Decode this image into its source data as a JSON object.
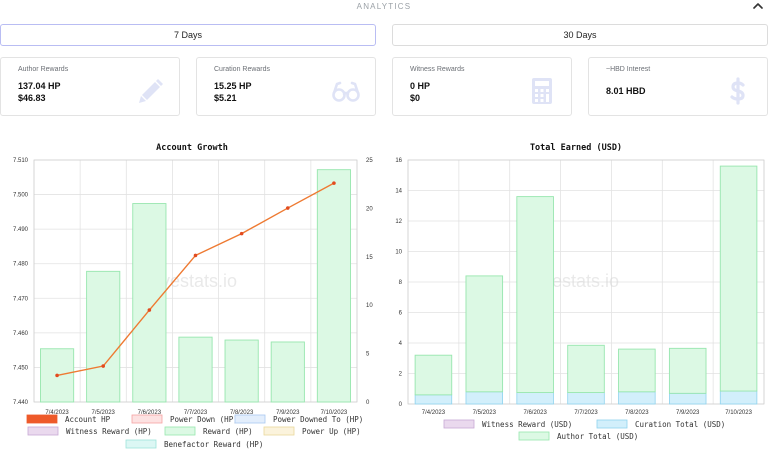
{
  "header": {
    "title": "ANALYTICS"
  },
  "range": {
    "btn7": "7 Days",
    "btn30": "30 Days"
  },
  "cards": {
    "author": {
      "label": "Author Rewards",
      "hp": "137.04 HP",
      "usd": "$46.83"
    },
    "curation": {
      "label": "Curation Rewards",
      "hp": "15.25 HP",
      "usd": "$5.21"
    },
    "witness": {
      "label": "Witness Rewards",
      "hp": "0 HP",
      "usd": "$0"
    },
    "hbd": {
      "label": "~HBD Interest",
      "value": "8.01 HBD"
    }
  },
  "icons": {
    "author": "pencil-icon",
    "curation": "glasses-icon",
    "witness": "calculator-icon",
    "hbd": "dollar-icon",
    "collapse": "chevron-up-icon"
  },
  "colors": {
    "bar_fill": "#dcf9e4",
    "bar_stroke": "#97e6ae",
    "line": "#ee7a32",
    "accent": "#b9bdf3",
    "icon": "#dfe3f6",
    "curation_fill": "#d2effb",
    "curation_stroke": "#8fd3ee"
  },
  "chart_data": [
    {
      "type": "bar",
      "title": "Account Growth",
      "watermark": "hivestats.io",
      "categories": [
        "7/4/2023",
        "7/5/2023",
        "7/6/2023",
        "7/7/2023",
        "7/8/2023",
        "7/9/2023",
        "7/10/2023"
      ],
      "y_left": {
        "ylim": [
          7.44,
          7.51
        ],
        "ticks": [
          "7.510",
          "7.500",
          "7.490",
          "7.480",
          "7.470",
          "7.460",
          "7.450",
          "7.440"
        ]
      },
      "y_right": {
        "ylim": [
          0,
          25
        ],
        "ticks": [
          "25",
          "20",
          "15",
          "10",
          "5",
          "0"
        ]
      },
      "series": [
        {
          "name": "Account HP",
          "type": "line",
          "axis": "left",
          "values": [
            7.4477,
            7.4504,
            7.4666,
            7.4824,
            7.4887,
            7.4961,
            7.5033
          ]
        },
        {
          "name": "Reward (HP)",
          "type": "bar",
          "axis": "right",
          "values": [
            5.5,
            13.5,
            20.5,
            6.7,
            6.4,
            6.2,
            24.0
          ]
        }
      ],
      "legend": [
        {
          "name": "Account HP",
          "fill": "#ee5a2a",
          "stroke": "#ee5a2a"
        },
        {
          "name": "Power Down (HP)",
          "fill": "#fde2e2",
          "stroke": "#f5a3a3"
        },
        {
          "name": "Power Downed To (HP)",
          "fill": "#e3eefc",
          "stroke": "#a9c8f0"
        },
        {
          "name": "Witness Reward (HP)",
          "fill": "#ead9ee",
          "stroke": "#c8a8d4"
        },
        {
          "name": "Reward (HP)",
          "fill": "#dcf9e4",
          "stroke": "#97e6ae"
        },
        {
          "name": "Power Up (HP)",
          "fill": "#fbf3dc",
          "stroke": "#ead89c"
        },
        {
          "name": "Benefactor Reward (HP)",
          "fill": "#dcf7f4",
          "stroke": "#9ee3da"
        }
      ],
      "grid": true
    },
    {
      "type": "bar",
      "title": "Total Earned (USD)",
      "watermark": "hivestats.io",
      "categories": [
        "7/4/2023",
        "7/5/2023",
        "7/6/2023",
        "7/7/2023",
        "7/8/2023",
        "7/9/2023",
        "7/10/2023"
      ],
      "ylim": [
        0,
        16
      ],
      "y_ticks": [
        "16",
        "14",
        "12",
        "10",
        "8",
        "6",
        "4",
        "2",
        "0"
      ],
      "series": [
        {
          "name": "Witness Reward (USD)",
          "values": [
            0,
            0,
            0,
            0,
            0,
            0,
            0
          ]
        },
        {
          "name": "Curation Total (USD)",
          "values": [
            0.6,
            0.8,
            0.75,
            0.75,
            0.8,
            0.7,
            0.85
          ]
        },
        {
          "name": "Author Total (USD)",
          "values": [
            2.6,
            7.6,
            12.85,
            3.1,
            2.8,
            2.95,
            14.75
          ]
        }
      ],
      "legend": [
        {
          "name": "Witness Reward (USD)",
          "fill": "#ead9ee",
          "stroke": "#c8a8d4"
        },
        {
          "name": "Curation Total (USD)",
          "fill": "#d2effb",
          "stroke": "#8fd3ee"
        },
        {
          "name": "Author Total (USD)",
          "fill": "#dcf9e4",
          "stroke": "#97e6ae"
        }
      ],
      "grid": true
    }
  ]
}
